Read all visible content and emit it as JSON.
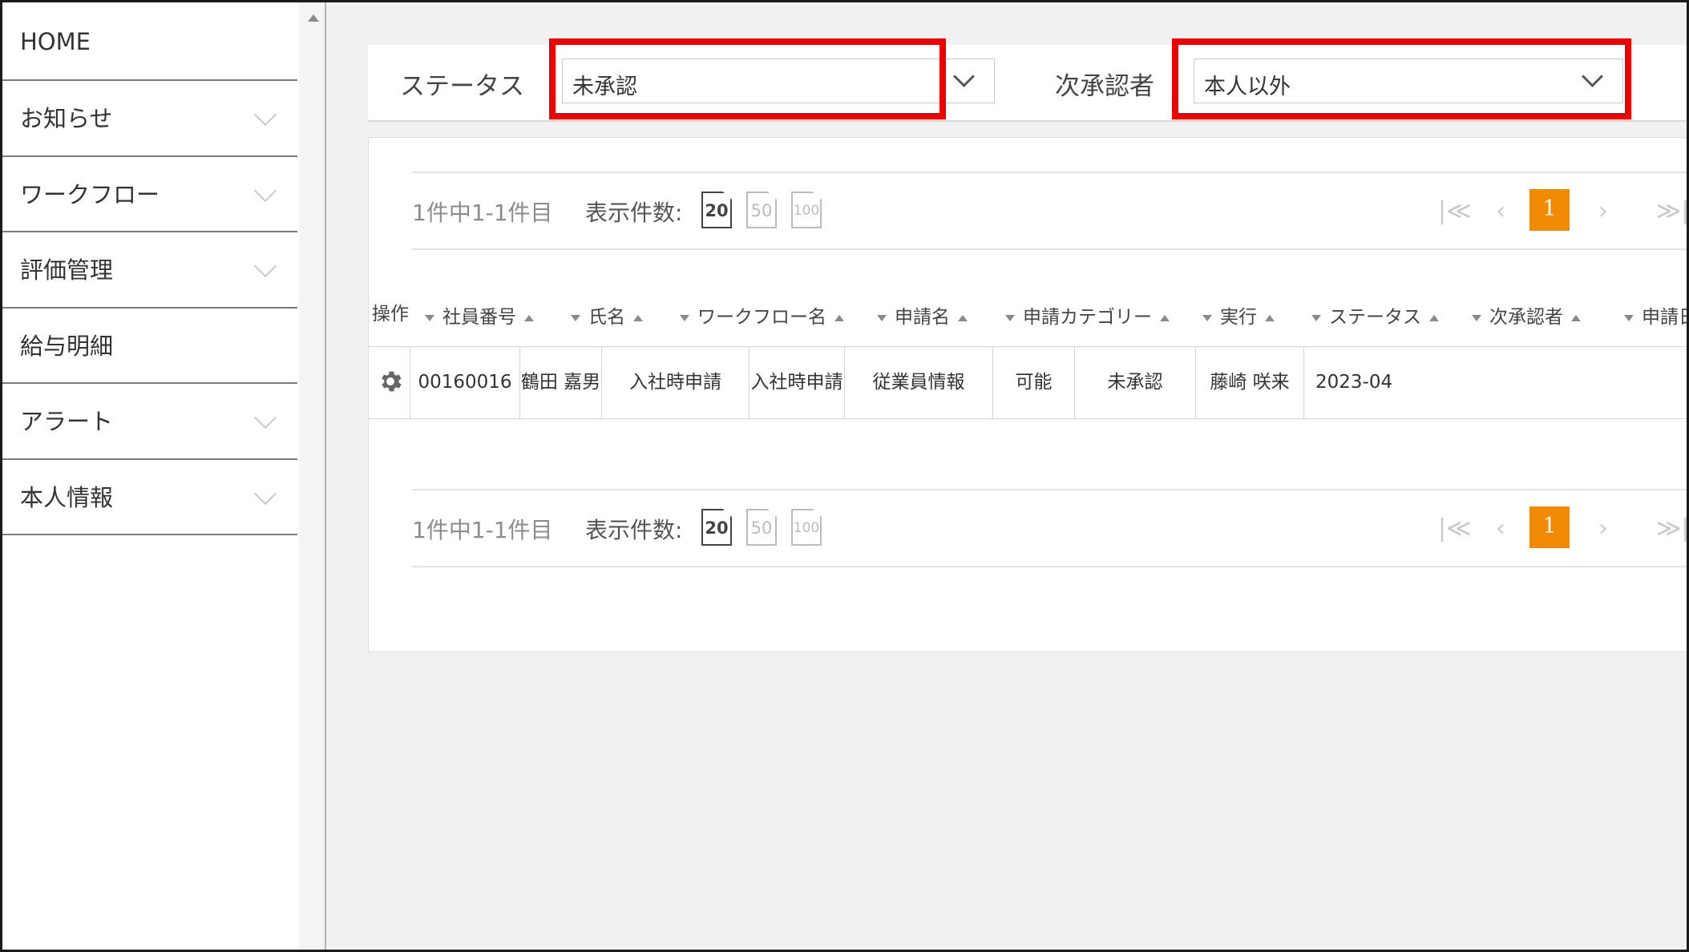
{
  "sidebar": {
    "items": [
      {
        "label": "HOME",
        "has_chevron": false
      },
      {
        "label": "お知らせ",
        "has_chevron": true
      },
      {
        "label": "ワークフロー",
        "has_chevron": true
      },
      {
        "label": "評価管理",
        "has_chevron": true
      },
      {
        "label": "給与明細",
        "has_chevron": false
      },
      {
        "label": "アラート",
        "has_chevron": true
      },
      {
        "label": "本人情報",
        "has_chevron": true
      }
    ]
  },
  "filters": {
    "status_label": "ステータス",
    "status_value": "未承認",
    "approver_label": "次承認者",
    "approver_value": "本人以外",
    "highlight_color": "#ee0000"
  },
  "pager": {
    "range_text": "1件中1-1件目",
    "size_label": "表示件数:",
    "sizes": [
      "20",
      "50",
      "100"
    ],
    "active_size": "20",
    "current_page": "1",
    "accent_color": "#f08a00",
    "icons": [
      "first-page-icon",
      "prev-page-icon",
      "next-page-icon",
      "last-page-icon"
    ]
  },
  "table": {
    "columns": [
      "操作",
      "社員番号",
      "氏名",
      "ワークフロー名",
      "申請名",
      "申請カテゴリー",
      "実行",
      "ステータス",
      "次承認者",
      "申請日"
    ],
    "rows": [
      {
        "action_icon": "gear-icon",
        "employee_no": "00160016",
        "name": "鶴田 嘉男",
        "workflow": "入社時申請",
        "application": "入社時申請",
        "category": "従業員情報",
        "execution": "可能",
        "status": "未承認",
        "next_approver": "藤崎 咲来",
        "date": "2023-04"
      }
    ]
  }
}
